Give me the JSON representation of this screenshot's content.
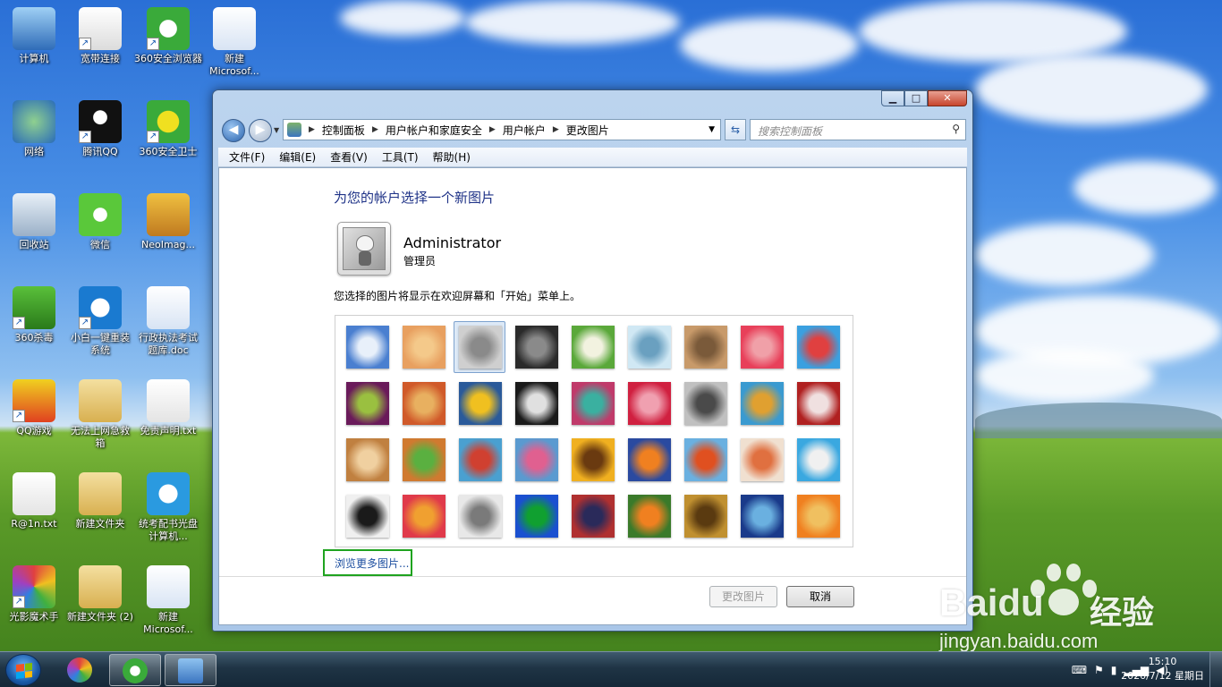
{
  "desktop": {
    "icons": [
      {
        "label": "计算机",
        "icon": "computer-icon"
      },
      {
        "label": "宽带连接",
        "icon": "document-shortcut-icon"
      },
      {
        "label": "360安全浏览器",
        "icon": "browser-360-icon"
      },
      {
        "label": "新建 Microsof...",
        "icon": "word-doc-icon"
      },
      {
        "label": "网络",
        "icon": "network-icon"
      },
      {
        "label": "腾讯QQ",
        "icon": "qq-penguin-icon"
      },
      {
        "label": "360安全卫士",
        "icon": "security-360-icon"
      },
      {
        "label": "回收站",
        "icon": "recycle-bin-icon"
      },
      {
        "label": "微信",
        "icon": "wechat-icon"
      },
      {
        "label": "NeoImag...",
        "icon": "neoimaging-icon"
      },
      {
        "label": "360杀毒",
        "icon": "antivirus-360-icon"
      },
      {
        "label": "小白一键重装系统",
        "icon": "reinstall-icon"
      },
      {
        "label": "行政执法考试题库.doc",
        "icon": "word-doc-icon"
      },
      {
        "label": "QQ游戏",
        "icon": "qq-game-icon"
      },
      {
        "label": "无法上网急救箱",
        "icon": "folder-icon"
      },
      {
        "label": "免责声明.txt",
        "icon": "text-file-icon"
      },
      {
        "label": "R@1n.txt",
        "icon": "text-file-icon"
      },
      {
        "label": "新建文件夹",
        "icon": "folder-icon"
      },
      {
        "label": "统考配书光盘计算机...",
        "icon": "media-player-icon"
      },
      {
        "label": "光影魔术手",
        "icon": "photo-tool-icon"
      },
      {
        "label": "新建文件夹 (2)",
        "icon": "folder-icon"
      },
      {
        "label": "新建 Microsof...",
        "icon": "word-doc-icon"
      }
    ]
  },
  "window": {
    "controls": {
      "minimize": "▁",
      "maximize": "□",
      "close": "✕"
    },
    "breadcrumb": [
      "控制面板",
      "用户帐户和家庭安全",
      "用户帐户",
      "更改图片"
    ],
    "search_placeholder": "搜索控制面板",
    "menu": [
      "文件(F)",
      "编辑(E)",
      "查看(V)",
      "工具(T)",
      "帮助(H)"
    ],
    "heading": "为您的帐户选择一个新图片",
    "user": {
      "name": "Administrator",
      "role": "管理员"
    },
    "description": "您选择的图片将显示在欢迎屏幕和「开始」菜单上。",
    "browse_link": "浏览更多图片...",
    "buttons": {
      "change": "更改图片",
      "cancel": "取消"
    },
    "pictures": [
      {
        "name": "roller-coaster",
        "c1": "#4a7fd0",
        "c2": "#e8f0fa"
      },
      {
        "name": "starfish",
        "c1": "#e8a060",
        "c2": "#f4c98a"
      },
      {
        "name": "robot-dog",
        "c1": "#cfcfcf",
        "c2": "#8a8a8a"
      },
      {
        "name": "turntable",
        "c1": "#2a2a2a",
        "c2": "#8a8a8a"
      },
      {
        "name": "lucky-cat",
        "c1": "#5aa83a",
        "c2": "#f2f2e0"
      },
      {
        "name": "gyroscope",
        "c1": "#d0e8f4",
        "c2": "#6aa0c0"
      },
      {
        "name": "kitten",
        "c1": "#c89a6a",
        "c2": "#7a5a3a"
      },
      {
        "name": "pink-flower",
        "c1": "#e8405a",
        "c2": "#f0a0a8"
      },
      {
        "name": "pinwheel",
        "c1": "#3aa0e0",
        "c2": "#e04040"
      },
      {
        "name": "ball",
        "c1": "#6a1a5a",
        "c2": "#9ac040"
      },
      {
        "name": "fabric",
        "c1": "#d05a2a",
        "c2": "#e8b060"
      },
      {
        "name": "leaf",
        "c1": "#2a5a9a",
        "c2": "#f0c020"
      },
      {
        "name": "dog",
        "c1": "#1a1a1a",
        "c2": "#e0e0e0"
      },
      {
        "name": "crayons",
        "c1": "#c03a6a",
        "c2": "#3ab0a0"
      },
      {
        "name": "red-star",
        "c1": "#d02040",
        "c2": "#f0a0b0"
      },
      {
        "name": "jacks",
        "c1": "#c0c0c0",
        "c2": "#4a4a4a"
      },
      {
        "name": "stairs",
        "c1": "#3a9ad0",
        "c2": "#e0a030"
      },
      {
        "name": "origami",
        "c1": "#b02020",
        "c2": "#f0e0e0"
      },
      {
        "name": "guitar",
        "c1": "#c08040",
        "c2": "#f0d0a0"
      },
      {
        "name": "pomeranian",
        "c1": "#d07a30",
        "c2": "#5ab040"
      },
      {
        "name": "toy-robot",
        "c1": "#4aa0d0",
        "c2": "#d04030"
      },
      {
        "name": "scarves",
        "c1": "#5a9ad0",
        "c2": "#e06090"
      },
      {
        "name": "sunflower",
        "c1": "#f0b020",
        "c2": "#6a3a10"
      },
      {
        "name": "fish",
        "c1": "#2a4aa0",
        "c2": "#f08020"
      },
      {
        "name": "balloon",
        "c1": "#6ab0e0",
        "c2": "#e05020"
      },
      {
        "name": "doll",
        "c1": "#f0e0d0",
        "c2": "#e07040"
      },
      {
        "name": "sailboat",
        "c1": "#3aa8e0",
        "c2": "#f0f0f0"
      },
      {
        "name": "soccer-ball",
        "c1": "#f0f0f0",
        "c2": "#1a1a1a"
      },
      {
        "name": "textile",
        "c1": "#e03a4a",
        "c2": "#f0a030"
      },
      {
        "name": "marbles",
        "c1": "#e8e8e8",
        "c2": "#7a7a7a"
      },
      {
        "name": "green-square",
        "c1": "#1a50d0",
        "c2": "#10a030"
      },
      {
        "name": "pattern",
        "c1": "#b03030",
        "c2": "#2a2a5a"
      },
      {
        "name": "butterfly",
        "c1": "#3a7a2a",
        "c2": "#f08020"
      },
      {
        "name": "shell",
        "c1": "#c09030",
        "c2": "#5a3a10"
      },
      {
        "name": "lighthouse",
        "c1": "#1a3a8a",
        "c2": "#6ab0e0"
      },
      {
        "name": "gerbera",
        "c1": "#f08020",
        "c2": "#f0c060"
      }
    ]
  },
  "taskbar": {
    "start": "start-orb-icon",
    "apps": [
      "photo-tool-icon",
      "browser-360-icon",
      "control-panel-icon"
    ],
    "tray": [
      "keyboard-icon",
      "flag-icon",
      "power-icon",
      "network-bars-icon",
      "volume-icon"
    ],
    "time": "15:10",
    "date": "2020/7/12 星期日"
  },
  "watermark": {
    "brand": "Baidu",
    "suffix": "经验",
    "url": "jingyan.baidu.com"
  }
}
